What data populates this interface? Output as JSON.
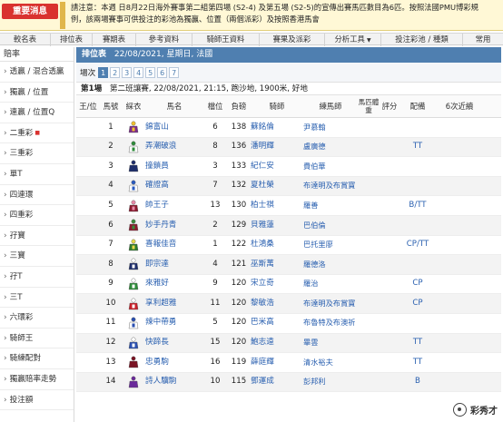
{
  "notice": {
    "tag": "重要消息",
    "text_line1": "請注意：本週 日8月22日海外賽事第二組第四場 (S2-4) 及第五場 (S2-5)的宣傳出賽馬匹數目為6匹。按照法國PMU博彩規",
    "text_line2": "例，該兩場賽事可供投注的彩池為獨贏、位置（兩個派彩）及按照香港馬會"
  },
  "nav": [
    {
      "label": "較名表",
      "dropdown": false
    },
    {
      "label": "排位表",
      "dropdown": false
    },
    {
      "label": "賽期表",
      "dropdown": false
    },
    {
      "label": "參考資料",
      "dropdown": false
    },
    {
      "label": "騎師王資料",
      "dropdown": false
    },
    {
      "label": "賽果及派彩",
      "dropdown": false
    },
    {
      "label": "分析工具",
      "dropdown": true
    },
    {
      "label": "投注彩池 / 種類",
      "dropdown": false
    },
    {
      "label": "常用",
      "dropdown": false
    }
  ],
  "sidebar": {
    "title": "賠率",
    "items": [
      {
        "label": "透贏 / 混合透贏",
        "new": false
      },
      {
        "label": "獨贏 / 位置",
        "new": false
      },
      {
        "label": "連贏 / 位置Q",
        "new": false
      },
      {
        "label": "二重彩",
        "new": true
      },
      {
        "label": "三重彩",
        "new": false
      },
      {
        "label": "單T",
        "new": false
      },
      {
        "label": "四連環",
        "new": false
      },
      {
        "label": "四重彩",
        "new": false
      },
      {
        "label": "孖寶",
        "new": false
      },
      {
        "label": "三寶",
        "new": false
      },
      {
        "label": "孖T",
        "new": false
      },
      {
        "label": "三T",
        "new": false
      },
      {
        "label": "六環彩",
        "new": false
      },
      {
        "label": "騎師王",
        "new": false
      },
      {
        "label": "騎練配對",
        "new": false
      },
      {
        "label": "獨贏賠率走勢",
        "new": false
      },
      {
        "label": "投注額",
        "new": false
      }
    ]
  },
  "title_bar": {
    "label": "排位表",
    "date": "22/08/2021, 星期日, 法國"
  },
  "race_selector": {
    "label": "場次",
    "races": [
      "1",
      "2",
      "3",
      "4",
      "5",
      "6",
      "7"
    ],
    "active": "1"
  },
  "race_info": {
    "race": "第1場",
    "details": "第二班讓賽, 22/08/2021, 21:15, 跑沙地, 1900米, 好地"
  },
  "columns": [
    "王/位",
    "馬號",
    "綵衣",
    "馬名",
    "檔位",
    "負磅",
    "騎師",
    "練馬師",
    "馬匹體重",
    "評分",
    "配備",
    "6次近續"
  ],
  "colors": {
    "title_bar": "#4f7fb0",
    "link": "#2a60b0",
    "notice_tag": "#d9322f"
  },
  "rows": [
    {
      "no": "1",
      "silk": "purple-yellow",
      "name": "錦富山",
      "draw": "6",
      "weight": "138",
      "jockey": "蘇銘倫",
      "trainer": "尹慕翰",
      "gear": ""
    },
    {
      "no": "2",
      "silk": "white-green",
      "name": "弄潮破浪",
      "draw": "8",
      "weight": "136",
      "jockey": "潘明輝",
      "trainer": "盧廣德",
      "gear": "TT"
    },
    {
      "no": "3",
      "silk": "navy",
      "name": "撞鎖員",
      "draw": "3",
      "weight": "133",
      "jockey": "紀仁安",
      "trainer": "費伯華",
      "gear": ""
    },
    {
      "no": "4",
      "silk": "white-blue",
      "name": "確證高",
      "draw": "7",
      "weight": "132",
      "jockey": "夏杜榮",
      "trainer": "布達明及布賞寶",
      "gear": ""
    },
    {
      "no": "5",
      "silk": "maroon-pink",
      "name": "帥王子",
      "draw": "13",
      "weight": "130",
      "jockey": "柏士祺",
      "trainer": "羅善",
      "gear": "B/TT"
    },
    {
      "no": "6",
      "silk": "maroon-green",
      "name": "妙手丹青",
      "draw": "2",
      "weight": "129",
      "jockey": "貝雅蓮",
      "trainer": "巴伯倫",
      "gear": ""
    },
    {
      "no": "7",
      "silk": "green-spots",
      "name": "喜報佳音",
      "draw": "1",
      "weight": "122",
      "jockey": "杜鴻桑",
      "trainer": "巴托里廖",
      "gear": "CP/TT"
    },
    {
      "no": "8",
      "silk": "navy-white",
      "name": "即宗達",
      "draw": "4",
      "weight": "121",
      "jockey": "巫斯萬",
      "trainer": "羅德洛",
      "gear": ""
    },
    {
      "no": "9",
      "silk": "green-white",
      "name": "來雅好",
      "draw": "9",
      "weight": "120",
      "jockey": "宋立奇",
      "trainer": "羅治",
      "gear": "CP"
    },
    {
      "no": "10",
      "silk": "red-white",
      "name": "享利超雅",
      "draw": "11",
      "weight": "120",
      "jockey": "黎敏浩",
      "trainer": "布達明及布賞寶",
      "gear": "CP"
    },
    {
      "no": "11",
      "silk": "blue-cross",
      "name": "辣中帶勇",
      "draw": "5",
      "weight": "120",
      "jockey": "巴米高",
      "trainer": "布魯特及布澳祈",
      "gear": ""
    },
    {
      "no": "12",
      "silk": "blue-white",
      "name": "快蹄長",
      "draw": "15",
      "weight": "120",
      "jockey": "鮑志遠",
      "trainer": "畢雲",
      "gear": "TT"
    },
    {
      "no": "13",
      "silk": "maroon",
      "name": "忠勇駒",
      "draw": "16",
      "weight": "119",
      "jockey": "薛庭輝",
      "trainer": "清水裕夫",
      "gear": "TT"
    },
    {
      "no": "14",
      "silk": "purple",
      "name": "詩人驥駒",
      "draw": "10",
      "weight": "115",
      "jockey": "鄧運成",
      "trainer": "彭邦利",
      "gear": "B"
    }
  ],
  "watermark": {
    "text": "彩秀才"
  }
}
